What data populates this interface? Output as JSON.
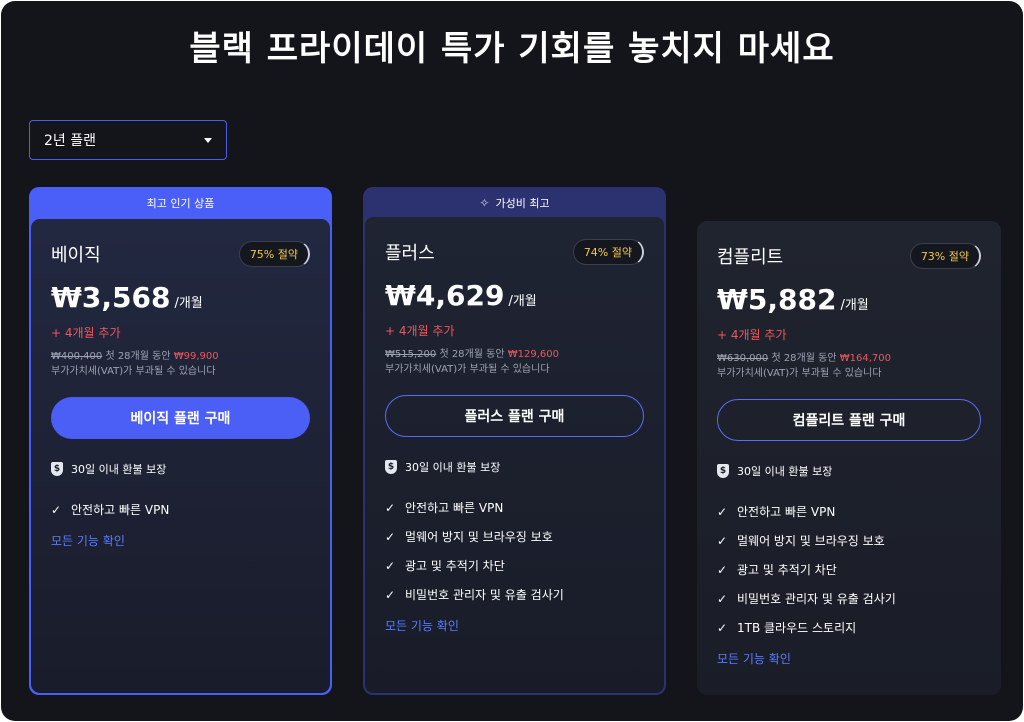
{
  "headline": "블랙 프라이데이 특가 기회를 놓치지 마세요",
  "plan_selector": {
    "value": "2년 플랜"
  },
  "cards": [
    {
      "banner": "최고 인기 상품",
      "name": "베이직",
      "discount": "75% 절약",
      "price": "₩3,568",
      "per": "/개월",
      "bonus": "+ 4개월 추가",
      "old_price": "₩400,400",
      "first_period": "첫 28개월 동안",
      "new_price": "₩99,900",
      "vat": "부가가치세(VAT)가 부과될 수 있습니다",
      "cta": "베이직 플랜 구매",
      "guarantee": "30일 이내 환불 보장",
      "features": [
        "안전하고 빠른 VPN"
      ],
      "more": "모든 기능 확인"
    },
    {
      "banner": "가성비 최고",
      "name": "플러스",
      "discount": "74% 절약",
      "price": "₩4,629",
      "per": "/개월",
      "bonus": "+ 4개월 추가",
      "old_price": "₩515,200",
      "first_period": "첫 28개월 동안",
      "new_price": "₩129,600",
      "vat": "부가가치세(VAT)가 부과될 수 있습니다",
      "cta": "플러스 플랜 구매",
      "guarantee": "30일 이내 환불 보장",
      "features": [
        "안전하고 빠른 VPN",
        "멀웨어 방지 및 브라우징 보호",
        "광고 및 추적기 차단",
        "비밀번호 관리자 및 유출 검사기"
      ],
      "more": "모든 기능 확인"
    },
    {
      "name": "컴플리트",
      "discount": "73% 절약",
      "price": "₩5,882",
      "per": "/개월",
      "bonus": "+ 4개월 추가",
      "old_price": "₩630,000",
      "first_period": "첫 28개월 동안",
      "new_price": "₩164,700",
      "vat": "부가가치세(VAT)가 부과될 수 있습니다",
      "cta": "컴플리트 플랜 구매",
      "guarantee": "30일 이내 환불 보장",
      "features": [
        "안전하고 빠른 VPN",
        "멀웨어 방지 및 브라우징 보호",
        "광고 및 추적기 차단",
        "비밀번호 관리자 및 유출 검사기",
        "1TB 클라우드 스토리지"
      ],
      "more": "모든 기능 확인"
    }
  ],
  "icons": {
    "dropdown": "chevron-down-icon",
    "guarantee": "shield-dollar-icon",
    "feature": "check-icon",
    "value_banner": "sparkle-icon"
  },
  "colors": {
    "background": "#14151a",
    "accent": "#4b5ef6",
    "discount_text": "#f2c94c",
    "bonus_text": "#f0565a",
    "link": "#5b7cff"
  }
}
